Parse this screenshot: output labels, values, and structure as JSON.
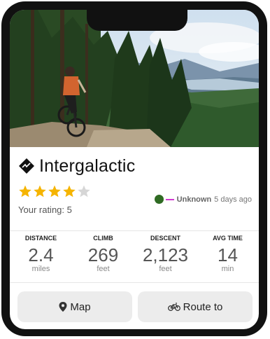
{
  "trail": {
    "name": "Intergalactic",
    "rating_label": "Your rating: 5",
    "stars_filled": 4,
    "stars_total": 5
  },
  "status": {
    "label": "Unknown",
    "time": "5 days ago",
    "dot_color": "#2f6b23",
    "line_color": "#d13bd1"
  },
  "stats": [
    {
      "label": "DISTANCE",
      "value": "2.4",
      "unit": "miles"
    },
    {
      "label": "CLIMB",
      "value": "269",
      "unit": "feet"
    },
    {
      "label": "DESCENT",
      "value": "2,123",
      "unit": "feet"
    },
    {
      "label": "AVG TIME",
      "value": "14",
      "unit": "min"
    }
  ],
  "actions": {
    "map_label": "Map",
    "route_label": "Route to"
  },
  "colors": {
    "star": "#f5b400",
    "star_empty": "#d6d6d6",
    "button_bg": "#ececec"
  },
  "icons": [
    "difficulty-diamond-icon",
    "star-icon",
    "map-pin-icon",
    "bicycle-icon"
  ]
}
